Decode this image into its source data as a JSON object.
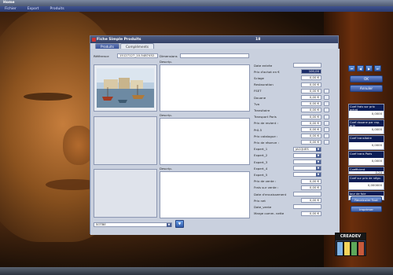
{
  "app": {
    "title": "Home",
    "menu": [
      "Fichier",
      "Export",
      "Produits"
    ]
  },
  "window": {
    "title": "Fiche Simple Produits",
    "number": "18",
    "tabs": [
      {
        "label": "Produits",
        "active": true
      },
      {
        "label": "Compléments",
        "active": false
      }
    ],
    "reference_label": "Référence",
    "reference_value": "15127127_10-5487452-",
    "dimensions_label": "Dimensions",
    "dimensions_value": "",
    "descrip_label": "Descrip.",
    "combo_value": "SOTBE",
    "fields": [
      {
        "label": "Date entrée",
        "value": "",
        "kind": "date"
      },
      {
        "label": "Prix d'achat en €",
        "value": "100,00",
        "kind": "selected"
      },
      {
        "label": "Sciage",
        "value": "0,00 €",
        "kind": "money"
      },
      {
        "label": "Restauration",
        "value": "0,00 €",
        "kind": "money"
      },
      {
        "label": "FSET",
        "value": "0,00 €",
        "kind": "money",
        "toggle": true
      },
      {
        "label": "Douane",
        "value": "0,00 €",
        "kind": "money",
        "toggle": true
      },
      {
        "label": "Tva",
        "value": "0,00 €",
        "kind": "money",
        "toggle": true
      },
      {
        "label": "Transitaire",
        "value": "0,00 €",
        "kind": "money",
        "toggle": true
      },
      {
        "label": "Transport Paris",
        "value": "0,00 €",
        "kind": "money",
        "toggle": true
      },
      {
        "label": "Prix de revient :",
        "value": "0,00 €",
        "kind": "money",
        "toggle": true
      },
      {
        "label": "Pr0.5",
        "value": "0,00 €",
        "kind": "money",
        "toggle": true
      },
      {
        "label": "Prix catalogue :",
        "value": "0,00 €",
        "kind": "money",
        "toggle": true
      },
      {
        "label": "Prix de réserve :",
        "value": "0,00 €",
        "kind": "money",
        "toggle": true
      },
      {
        "label": "Expert_1",
        "value": "JACQUES",
        "kind": "combo"
      },
      {
        "label": "Expert_2",
        "value": "",
        "kind": "combo"
      },
      {
        "label": "Expert_3",
        "value": "",
        "kind": "combo"
      },
      {
        "label": "Expert_4",
        "value": "",
        "kind": "combo"
      },
      {
        "label": "Expert_5",
        "value": "",
        "kind": "combo"
      },
      {
        "label": "Prix de vente :",
        "value": "0,00 €",
        "kind": "money"
      },
      {
        "label": "Frais sur vente :",
        "value": "0,00 €",
        "kind": "money"
      },
      {
        "label": "Date d'encaissement",
        "value": "",
        "kind": "date"
      },
      {
        "label": "Prix net",
        "value": "0,00 €",
        "kind": "money"
      },
      {
        "label": "Date_vente",
        "value": "",
        "kind": "date"
      },
      {
        "label": "Marge comm. nette",
        "value": "0,00 €",
        "kind": "money"
      }
    ]
  },
  "right_panel": {
    "nav": [
      "⏮",
      "◀",
      "▶",
      "⏭"
    ],
    "ok_label": "OK",
    "cancel_label": "Annuler",
    "coefficients": [
      {
        "label": "Coef frais sur prix achat",
        "value": "0,0000"
      },
      {
        "label": "Coef douane par rap. prix",
        "value": "0,0000"
      },
      {
        "label": "Coef transitaire",
        "value": "0,0000"
      },
      {
        "label": "Coef trans Paris",
        "value": "0,0000"
      },
      {
        "label": "Coefficient",
        "value": "0,20"
      },
      {
        "label": "Coef sur prix de négo.",
        "value": "0,000000"
      },
      {
        "label": "Jour de foie",
        "value": "0,7960"
      }
    ],
    "recalc_label": "Recalculer Tout",
    "print_label": "Imprimer"
  },
  "brand": {
    "name": "CREADEV"
  }
}
